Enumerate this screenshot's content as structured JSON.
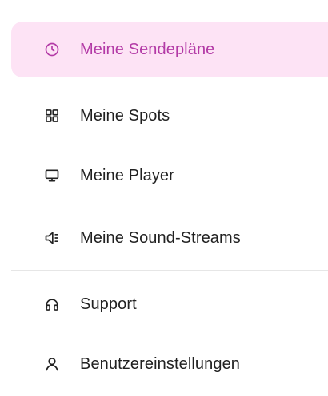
{
  "nav": {
    "primary": [
      {
        "id": "sendeplaene",
        "label": "Meine Sendepläne",
        "icon": "clock-icon",
        "active": true
      },
      {
        "id": "spots",
        "label": "Meine Spots",
        "icon": "grid-icon",
        "active": false
      },
      {
        "id": "player",
        "label": "Meine Player",
        "icon": "monitor-icon",
        "active": false
      },
      {
        "id": "sound-streams",
        "label": "Meine Sound-Streams",
        "icon": "speaker-icon",
        "active": false
      }
    ],
    "secondary": [
      {
        "id": "support",
        "label": "Support",
        "icon": "headphones-icon",
        "active": false
      },
      {
        "id": "benutzereinstellungen",
        "label": "Benutzereinstellungen",
        "icon": "user-icon",
        "active": false
      }
    ]
  },
  "colors": {
    "active_background": "#fde3f5",
    "active_text": "#b33aa6",
    "text": "#212121",
    "divider": "#e6e6e6"
  }
}
